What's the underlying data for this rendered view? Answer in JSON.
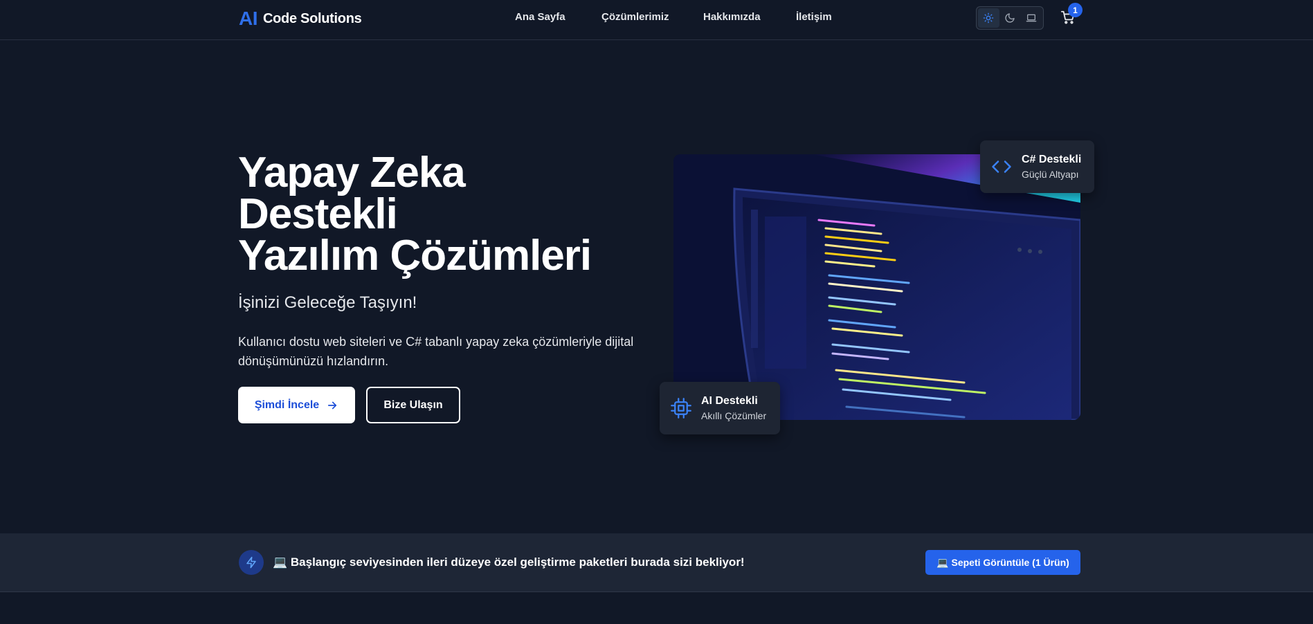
{
  "header": {
    "logo_ai": "AI",
    "logo_text": "Code Solutions",
    "nav": [
      {
        "label": "Ana Sayfa"
      },
      {
        "label": "Çözümlerimiz"
      },
      {
        "label": "Hakkımızda"
      },
      {
        "label": "İletişim"
      }
    ],
    "theme_options": [
      "sun-icon",
      "moon-icon",
      "laptop-icon"
    ],
    "theme_selected": "light",
    "cart_count": "1"
  },
  "hero": {
    "title_lines": [
      "Yapay Zeka",
      "Destekli",
      "Yazılım Çözümleri"
    ],
    "subtitle": "İşinizi Geleceğe Taşıyın!",
    "description": "Kullanıcı dostu web siteleri ve C# tabanlı yapay zeka çözümleriyle dijital dönüşümünüzü hızlandırın.",
    "primary_button": "Şimdi İncele",
    "secondary_button": "Bize Ulaşın"
  },
  "cards": {
    "csharp": {
      "title": "C# Destekli",
      "subtitle": "Güçlü Altyapı",
      "icon": "code-icon"
    },
    "ai": {
      "title": "AI Destekli",
      "subtitle": "Akıllı Çözümler",
      "icon": "cpu-icon"
    }
  },
  "banner": {
    "icon": "lightning-icon",
    "text": "💻 Başlangıç seviyesinden ileri düzeye özel geliştirme paketleri burada sizi bekliyor!",
    "button": "💻 Sepeti Görüntüle (1 Ürün)"
  },
  "colors": {
    "background": "#111827",
    "accent": "#2563eb",
    "card": "#1e2533"
  }
}
